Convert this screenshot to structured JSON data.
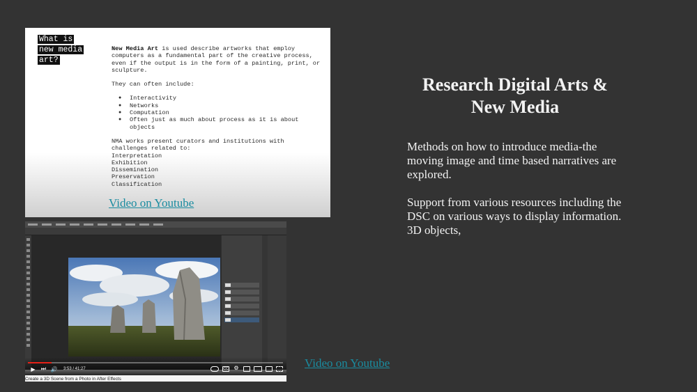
{
  "slide": {
    "title": "Research Digital Arts & New Media",
    "paragraphs": [
      "Methods on how to introduce media-the moving image and time based narratives are explored.",
      "Support from various resources including the DSC on various ways to display information. 3D objects,"
    ],
    "links": {
      "doc_video_link": "Video on Youtube",
      "thumb_video_link": "Video on Youtube"
    },
    "link_color": "#1a8ca0",
    "background": "#333333"
  },
  "document_image": {
    "heading_lines": [
      "What is",
      "new media",
      "art?"
    ],
    "intro_bold": "New Media Art",
    "intro_rest": " is used describe artworks that employ computers as a fundamental part of the creative process, even if the output is in the form of a painting, print, or sculpture.",
    "list_intro": "They can often include:",
    "bullets": [
      "Interactivity",
      "Networks",
      "Computation",
      "Often just as much about process as it is about objects"
    ],
    "challenges_intro": "NMA works present curators and institutions with challenges related to:",
    "challenges": [
      "Interpretation",
      "Exhibition",
      "Dissemination",
      "Preservation",
      "Classification"
    ]
  },
  "video_thumbnail": {
    "time": "3:53 / 41:27",
    "progress": 0.094,
    "caption": "Create a 3D Scene from a Photo in After Effects",
    "progress_color": "#e62117",
    "icons": [
      "play-icon",
      "next-icon",
      "volume-icon",
      "autoplay-toggle-icon",
      "subtitles-icon",
      "settings-icon",
      "miniplayer-icon",
      "theater-icon",
      "cast-icon",
      "fullscreen-icon"
    ]
  }
}
